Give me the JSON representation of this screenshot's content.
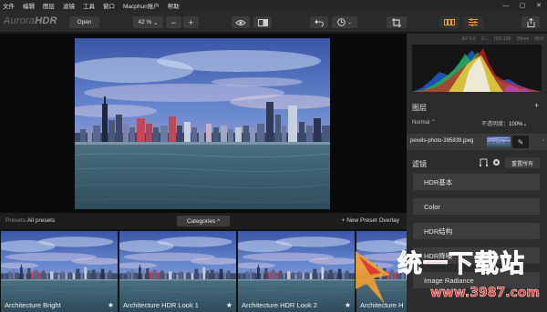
{
  "menu": [
    "文件",
    "编辑",
    "图层",
    "滤镜",
    "工具",
    "窗口",
    "Macphun账户",
    "帮助"
  ],
  "window_controls": [
    "—",
    "▢",
    "✕"
  ],
  "app": {
    "logo_prefix": "Aurora",
    "logo_suffix": "HDR"
  },
  "toolbar": {
    "open_label": "Open",
    "zoom_label": "42 %",
    "zoom_out": "−",
    "zoom_in": "+"
  },
  "presets": {
    "label": "Presets:",
    "current": "All presets",
    "categories_label": "Categories ^",
    "new_overlay_label": "+ New Preset Overlay",
    "items": [
      {
        "name": "Architecture Bright"
      },
      {
        "name": "Architecture HDR Look 1"
      },
      {
        "name": "Architecture HDR Look 2"
      },
      {
        "name": "Architecture H"
      }
    ],
    "star": "★"
  },
  "histogram": {
    "info": [
      "EV 0.0",
      "1/...",
      "ISO 100",
      "30mm",
      "f/8.0"
    ]
  },
  "layers": {
    "title": "图层",
    "add": "+",
    "blend_mode": "Normal ⌃",
    "opacity_label": "不透明度：",
    "opacity_value": "100%⌄",
    "layer_name": "pexels-photo-395839.jpeg",
    "brush": "✎",
    "lock": "▪"
  },
  "filters": {
    "title": "滤镜",
    "reset_label": "重置所有",
    "items": [
      "HDR基本",
      "Color",
      "HDR结构",
      "HDR降噪",
      "Image Radiance"
    ]
  },
  "watermark": {
    "text": "统一下载站",
    "url": "www.3987.com"
  },
  "colors": {
    "accent_orange": "#f0a030",
    "panel": "#2c2c2c",
    "toolbar": "#2a2a2a",
    "watermark_red": "#e03030"
  }
}
